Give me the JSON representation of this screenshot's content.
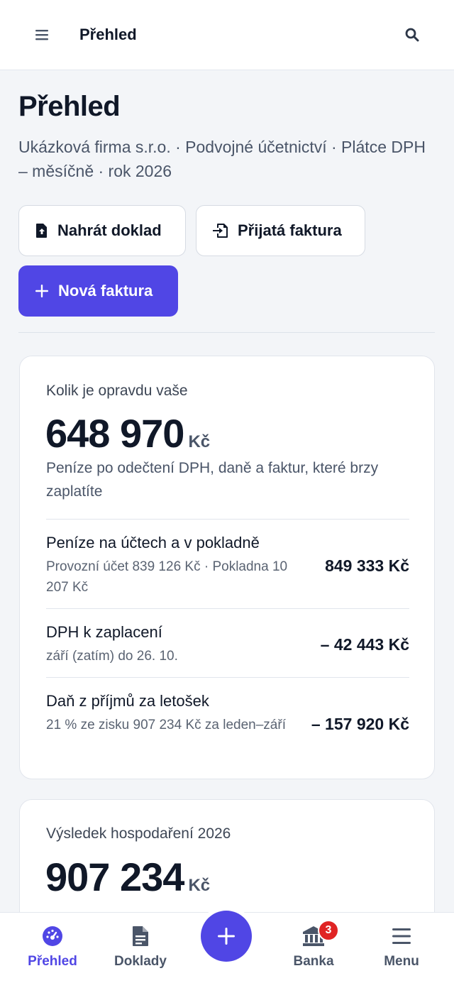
{
  "header": {
    "title": "Přehled"
  },
  "page": {
    "title": "Přehled",
    "subtitle": "Ukázková firma s.r.o. · Podvojné účetnictví · Plátce DPH – měsíčně · rok 2026"
  },
  "actions": {
    "upload_label": "Nahrát doklad",
    "received_label": "Přijatá faktura",
    "new_invoice_label": "Nová faktura"
  },
  "card_available": {
    "label": "Kolik je opravdu vaše",
    "amount": "648 970",
    "unit": "Kč",
    "description": "Peníze po odečtení DPH, daně a faktur, které brzy zaplatíte",
    "rows": [
      {
        "title": "Peníze na účtech a v pokladně",
        "sub": "Provozní účet 839 126 Kč · Pokladna 10 207 Kč",
        "amount": "849 333 Kč"
      },
      {
        "title": "DPH k zaplacení",
        "sub": "září (zatím) do 26. 10.",
        "amount": "– 42 443 Kč"
      },
      {
        "title": "Daň z příjmů za letošek",
        "sub": "21 % ze zisku 907 234 Kč za leden–září",
        "amount": "– 157 920 Kč"
      }
    ]
  },
  "card_result": {
    "label": "Výsledek hospodaření 2026",
    "amount": "907 234",
    "unit": "Kč"
  },
  "bottom_nav": {
    "items": [
      {
        "label": "Přehled",
        "icon": "dashboard-icon",
        "active": true
      },
      {
        "label": "Doklady",
        "icon": "document-icon",
        "active": false
      },
      {
        "label": "Banka",
        "icon": "bank-icon",
        "active": false,
        "badge": "3"
      },
      {
        "label": "Menu",
        "icon": "menu-icon",
        "active": false
      }
    ]
  },
  "colors": {
    "accent": "#5046e5",
    "badge": "#e02424",
    "background": "#f3f5f8"
  }
}
